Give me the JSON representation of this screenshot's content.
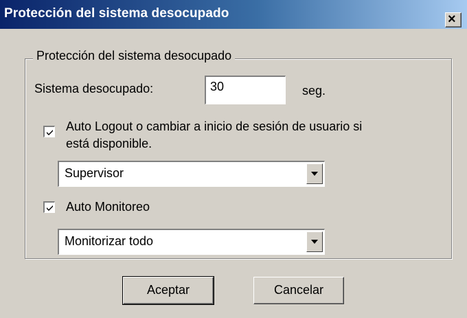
{
  "window": {
    "title": "Protección del sistema desocupado",
    "close_glyph": "×"
  },
  "group": {
    "title": "Protección del sistema desocupado"
  },
  "idle": {
    "label": "Sistema desocupado:",
    "value": "30",
    "unit": "seg."
  },
  "auto_logout": {
    "checked": true,
    "label_line1": "Auto Logout o cambiar a inicio de sesión de usuario si",
    "label_line2": "está disponible.",
    "selected": "Supervisor"
  },
  "auto_monitor": {
    "checked": true,
    "label": "Auto Monitoreo",
    "selected": "Monitorizar todo"
  },
  "buttons": {
    "ok": "Aceptar",
    "cancel": "Cancelar"
  }
}
